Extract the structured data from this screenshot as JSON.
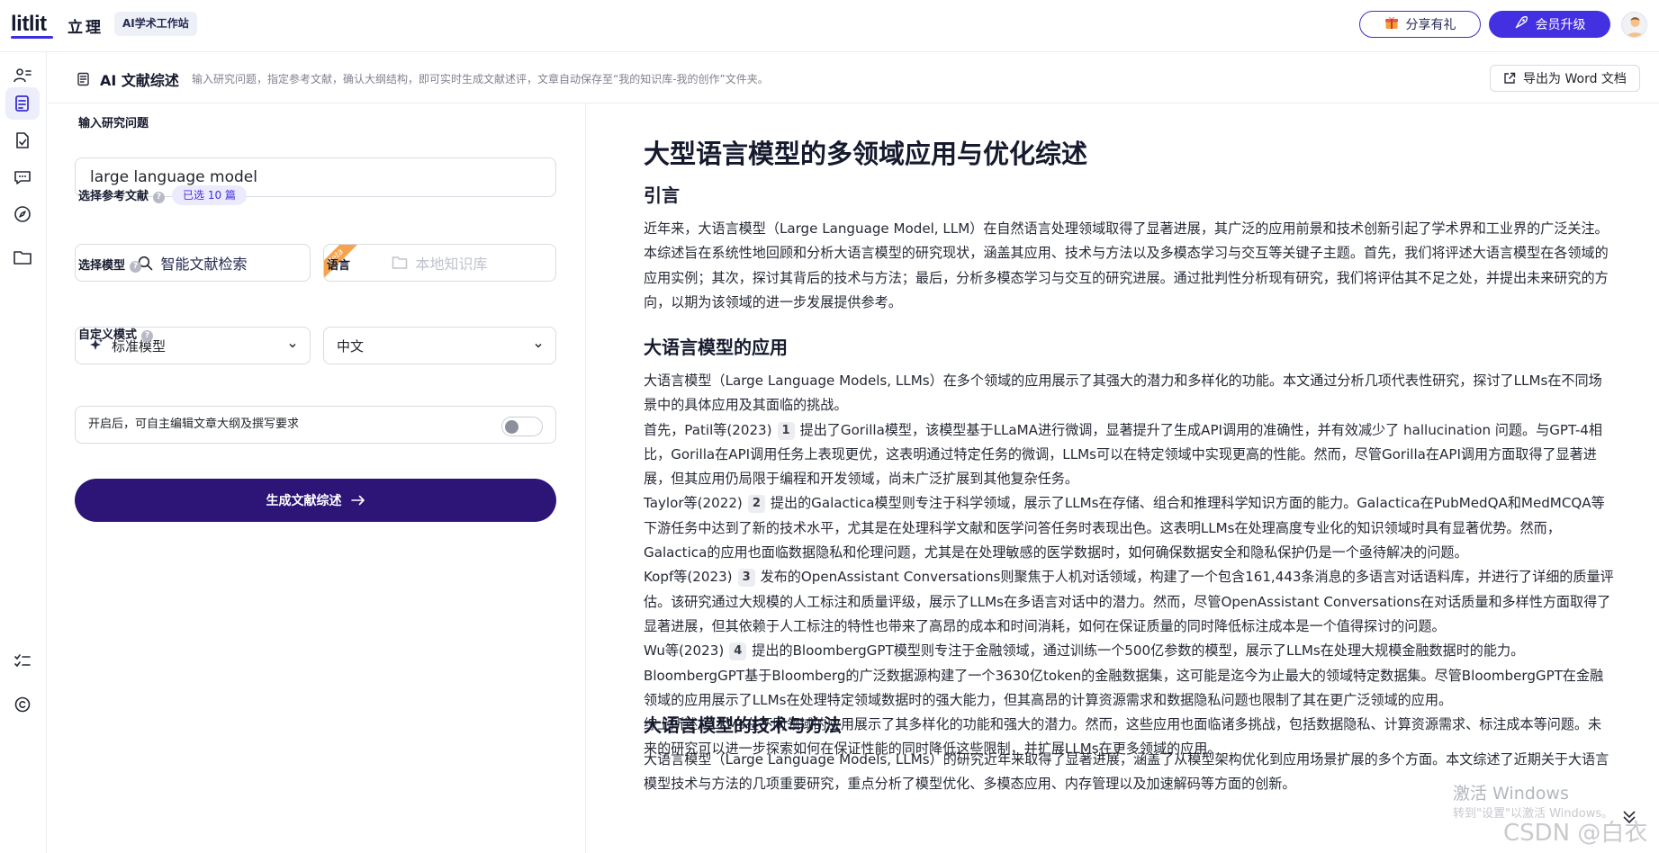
{
  "topbar": {
    "logo": "litlit",
    "brand_cn": "立理",
    "badge": "AI学术工作站",
    "share_label": "分享有礼",
    "vip_label": "会员升级"
  },
  "sidebar": {
    "items": [
      "team-icon",
      "review-icon",
      "document-check-icon",
      "chat-icon",
      "compass-icon",
      "folder-icon",
      "checklist-icon",
      "copyright-icon"
    ]
  },
  "subheader": {
    "title": "AI 文献综述",
    "description": "输入研究问题，指定参考文献，确认大纲结构，即可实时生成文献述评，文章自动保存至“我的知识库-我的创作”文件夹。",
    "export_label": "导出为 Word 文档"
  },
  "form": {
    "question_label": "输入研究问题",
    "question_value": "large language model",
    "refs_label": "选择参考文献",
    "selected_badge": "已选 10 篇",
    "smart_search_label": "智能文献检索",
    "local_label": "本地知识库",
    "beta_label": "Beta",
    "model_label": "选择模型",
    "model_value": "标准模型",
    "lang_label": "语言",
    "lang_value": "中文",
    "custom_label": "自定义模式",
    "custom_desc": "开启后，可自主编辑文章大纲及撰写要求",
    "custom_enabled": false,
    "generate_label": "生成文献综述"
  },
  "article": {
    "title": "大型语言模型的多领域应用与优化综述",
    "sections": [
      {
        "heading": "引言",
        "paragraphs": [
          "近年来，大语言模型（Large Language Model, LLM）在自然语言处理领域取得了显著进展，其广泛的应用前景和技术创新引起了学术界和工业界的广泛关注。本综述旨在系统性地回顾和分析大语言模型的研究现状，涵盖其应用、技术与方法以及多模态学习与交互等关键子主题。首先，我们将评述大语言模型在各领域的应用实例；其次，探讨其背后的技术与方法；最后，分析多模态学习与交互的研究进展。通过批判性分析现有研究，我们将评估其不足之处，并提出未来研究的方向，以期为该领域的进一步发展提供参考。"
        ]
      },
      {
        "heading": "大语言模型的应用",
        "intro": "大语言模型（Large Language Models, LLMs）在多个领域的应用展示了其强大的潜力和多样化的功能。本文通过分析几项代表性研究，探讨了LLMs在不同场景中的具体应用及其面临的挑战。",
        "cited": [
          {
            "before": "首先，Patil等(2023)",
            "ref": "1",
            "after": "提出了Gorilla模型，该模型基于LLaMA进行微调，显著提升了生成API调用的准确性，并有效减少了 hallucination 问题。与GPT-4相比，Gorilla在API调用任务上表现更优，这表明通过特定任务的微调，LLMs可以在特定领域中实现更高的性能。然而，尽管Gorilla在API调用方面取得了显著进展，但其应用仍局限于编程和开发领域，尚未广泛扩展到其他复杂任务。"
          },
          {
            "before": "Taylor等(2022)",
            "ref": "2",
            "after": "提出的Galactica模型则专注于科学领域，展示了LLMs在存储、组合和推理科学知识方面的能力。Galactica在PubMedQA和MedMCQA等下游任务中达到了新的技术水平，尤其是在处理科学文献和医学问答任务时表现出色。这表明LLMs在处理高度专业化的知识领域时具有显著优势。然而，Galactica的应用也面临数据隐私和伦理问题，尤其是在处理敏感的医学数据时，如何确保数据安全和隐私保护仍是一个亟待解决的问题。"
          },
          {
            "before": "Kopf等(2023)",
            "ref": "3",
            "after": "发布的OpenAssistant Conversations则聚焦于人机对话领域，构建了一个包含161,443条消息的多语言对话语料库，并进行了详细的质量评估。该研究通过大规模的人工标注和质量评级，展示了LLMs在多语言对话中的潜力。然而，尽管OpenAssistant Conversations在对话质量和多样性方面取得了显著进展，但其依赖于人工标注的特性也带来了高昂的成本和时间消耗，如何在保证质量的同时降低标注成本是一个值得探讨的问题。"
          },
          {
            "before": "Wu等(2023)",
            "ref": "4",
            "after": "提出的BloombergGPT模型则专注于金融领域，通过训练一个500亿参数的模型，展示了LLMs在处理大规模金融数据时的能力。BloombergGPT基于Bloomberg的广泛数据源构建了一个3630亿token的金融数据集，这可能是迄今为止最大的领域特定数据集。尽管BloombergGPT在金融领域的应用展示了LLMs在处理特定领域数据时的强大能力，但其高昂的计算资源需求和数据隐私问题也限制了其在更广泛领域的应用。"
          }
        ],
        "conclusion": "综上所述，LLMs在不同领域的应用展示了其多样化的功能和强大的潜力。然而，这些应用也面临诸多挑战，包括数据隐私、计算资源需求、标注成本等问题。未来的研究可以进一步探索如何在保证性能的同时降低这些限制，并扩展LLMs在更多领域的应用。"
      },
      {
        "heading": "大语言模型的技术与方法",
        "paragraphs": [
          "大语言模型（Large Language Models, LLMs）的研究近年来取得了显著进展，涵盖了从模型架构优化到应用场景扩展的多个方面。本文综述了近期关于大语言模型技术与方法的几项重要研究，重点分析了模型优化、多模态应用、内存管理以及加速解码等方面的创新。"
        ]
      }
    ]
  },
  "overlay": {
    "activation_title": "激活 Windows",
    "activation_sub": "转到\"设置\"以激活 Windows。",
    "csdn_mark": "CSDN @白衣人猜机"
  }
}
